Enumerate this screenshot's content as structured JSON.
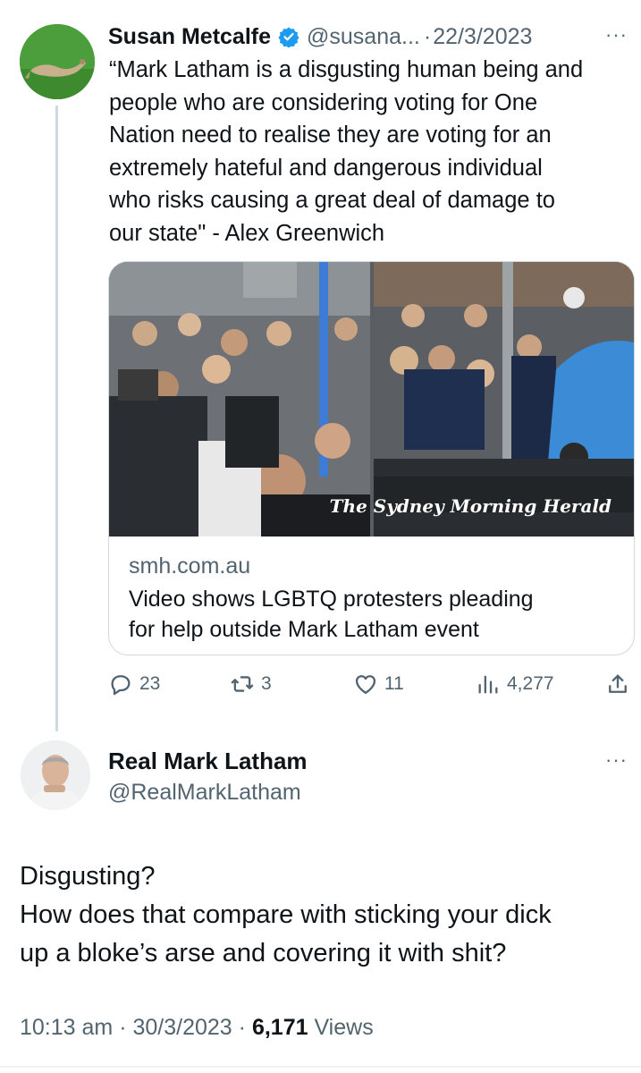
{
  "parent_tweet": {
    "author_name": "Susan Metcalfe",
    "handle": "@susana...",
    "separator": "·",
    "date": "22/3/2023",
    "more_label": "···",
    "text": "“Mark Latham is a disgusting human being and\npeople who are considering voting for One\nNation need to realise they are voting for an\nextremely hateful and dangerous individual\nwho risks causing a great deal of damage to\nour state\" - Alex Greenwich",
    "link_card": {
      "image_watermark": "The Sydney Morning Herald",
      "domain": "smh.com.au",
      "title": "Video shows LGBTQ protesters pleading\nfor help outside Mark Latham event"
    },
    "actions": {
      "replies": "23",
      "retweets": "3",
      "likes": "11",
      "views": "4,277"
    },
    "icons": [
      "verified-badge-icon",
      "reply-icon",
      "retweet-icon",
      "like-icon",
      "views-icon",
      "share-icon",
      "more-icon"
    ]
  },
  "reply_tweet": {
    "author_name": "Real Mark Latham",
    "handle": "@RealMarkLatham",
    "more_label": "···",
    "text": "Disgusting?\nHow does that compare with sticking your dick\nup a bloke’s arse and covering it with shit?",
    "time": "10:13 am",
    "separator": "·",
    "date": "30/3/2023",
    "views_count": "6,171",
    "views_label": "Views"
  },
  "colors": {
    "text_primary": "#0f1419",
    "text_secondary": "#536471",
    "verified_blue": "#1d9bf0",
    "border": "#cfd9de"
  }
}
